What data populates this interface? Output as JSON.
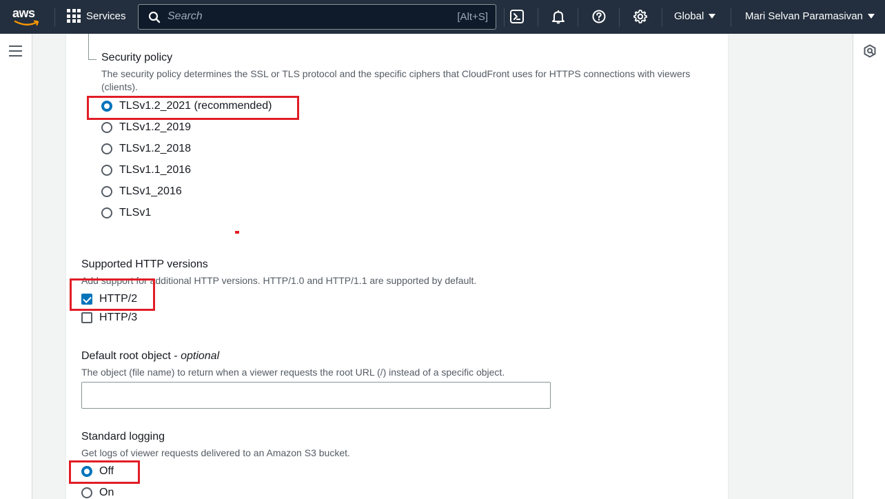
{
  "nav": {
    "logo_text": "aws",
    "services_label": "Services",
    "search_placeholder": "Search",
    "search_shortcut": "[Alt+S]",
    "region_label": "Global",
    "user_label": "Mari Selvan Paramasivan"
  },
  "security_policy": {
    "label": "Security policy",
    "description": "The security policy determines the SSL or TLS protocol and the specific ciphers that CloudFront uses for HTTPS connections with viewers (clients).",
    "options": [
      {
        "label": "TLSv1.2_2021 (recommended)",
        "selected": true
      },
      {
        "label": "TLSv1.2_2019",
        "selected": false
      },
      {
        "label": "TLSv1.2_2018",
        "selected": false
      },
      {
        "label": "TLSv1.1_2016",
        "selected": false
      },
      {
        "label": "TLSv1_2016",
        "selected": false
      },
      {
        "label": "TLSv1",
        "selected": false
      }
    ]
  },
  "http_versions": {
    "label": "Supported HTTP versions",
    "description": "Add support for additional HTTP versions. HTTP/1.0 and HTTP/1.1 are supported by default.",
    "options": [
      {
        "label": "HTTP/2",
        "checked": true
      },
      {
        "label": "HTTP/3",
        "checked": false
      }
    ]
  },
  "default_root": {
    "label": "Default root object - ",
    "label_optional": "optional",
    "description": "The object (file name) to return when a viewer requests the root URL (/) instead of a specific object.",
    "value": ""
  },
  "standard_logging": {
    "label": "Standard logging",
    "description": "Get logs of viewer requests delivered to an Amazon S3 bucket.",
    "options": [
      {
        "label": "Off",
        "selected": true
      },
      {
        "label": "On",
        "selected": false
      }
    ]
  },
  "colors": {
    "nav_bg": "#232f3e",
    "accent": "#0073bb",
    "highlight": "#e11d26"
  }
}
